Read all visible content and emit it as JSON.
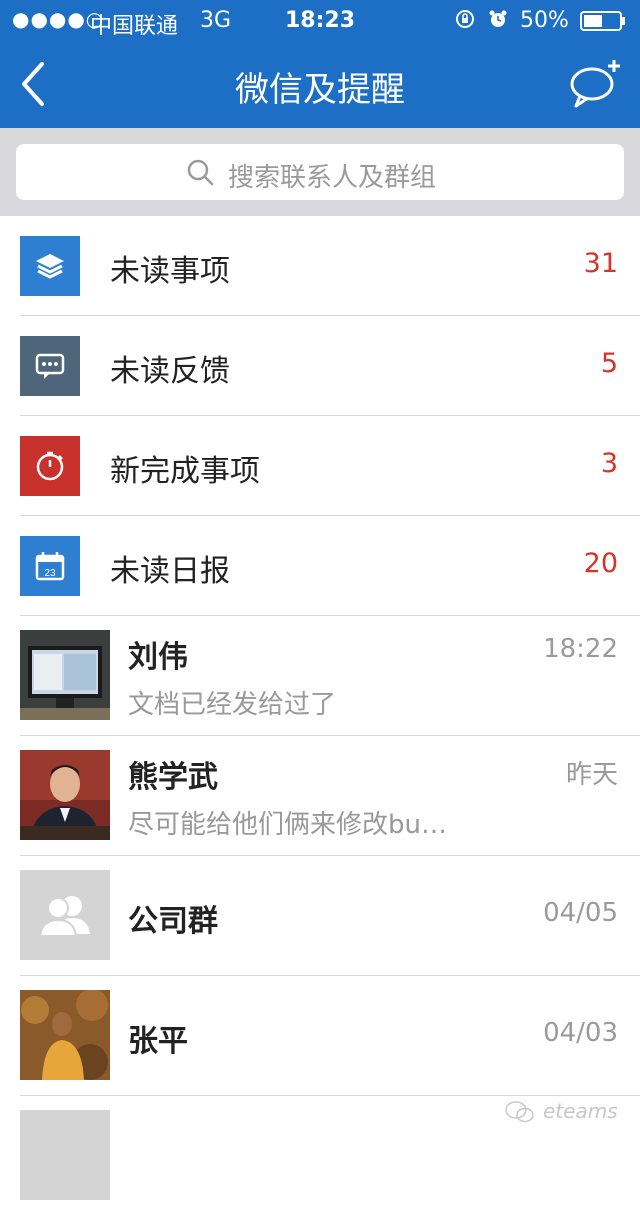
{
  "status_bar": {
    "signal": "●●●●○",
    "carrier": "中国联通",
    "network": "3G",
    "time": "18:23",
    "battery": "50%"
  },
  "nav": {
    "title": "微信及提醒"
  },
  "search": {
    "placeholder": "搜索联系人及群组"
  },
  "notifications": [
    {
      "label": "未读事项",
      "count": "31",
      "icon": "layers-icon",
      "color": "#2e7fd2"
    },
    {
      "label": "未读反馈",
      "count": "5",
      "icon": "comment-dots-icon",
      "color": "#4f6579"
    },
    {
      "label": "新完成事项",
      "count": "3",
      "icon": "stopwatch-icon",
      "color": "#c9312c"
    },
    {
      "label": "未读日报",
      "count": "20",
      "icon": "calendar-icon",
      "color": "#2e7fd2",
      "calendar_day": "23"
    }
  ],
  "chats": [
    {
      "name": "刘伟",
      "preview": "文档已经发给过了",
      "time": "18:22",
      "avatar": "monitor-photo"
    },
    {
      "name": "熊学武",
      "preview": "尽可能给他们俩来修改bu…",
      "time": "昨天",
      "avatar": "person-photo"
    },
    {
      "name": "公司群",
      "preview": "",
      "time": "04/05",
      "avatar": "group-placeholder-icon"
    },
    {
      "name": "张平",
      "preview": "",
      "time": "04/03",
      "avatar": "blurred-person-photo"
    }
  ],
  "watermark": "eteams"
}
